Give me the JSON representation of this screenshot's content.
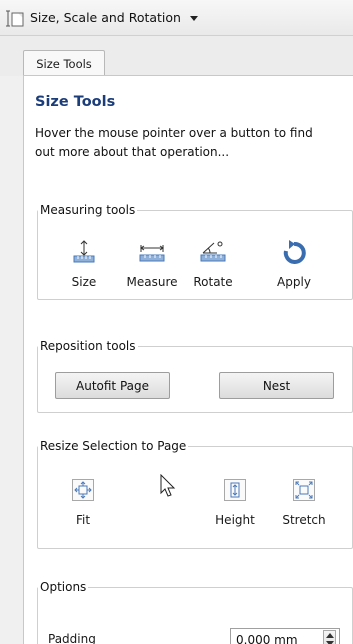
{
  "header": {
    "title": "Size, Scale and Rotation"
  },
  "tabs": [
    {
      "label": "Size Tools"
    }
  ],
  "panel": {
    "title": "Size Tools",
    "description": "Hover the mouse pointer over a button to find out more about that operation..."
  },
  "measuring": {
    "legend": "Measuring tools",
    "tools": [
      {
        "label": "Size",
        "icon": "size-icon"
      },
      {
        "label": "Measure",
        "icon": "measure-icon"
      },
      {
        "label": "Rotate",
        "icon": "rotate-angle-icon"
      },
      {
        "label": "Apply",
        "icon": "apply-rotate-icon"
      }
    ]
  },
  "reposition": {
    "legend": "Reposition tools",
    "buttons": [
      {
        "label": "Autofit Page"
      },
      {
        "label": "Nest"
      }
    ]
  },
  "resize": {
    "legend": "Resize Selection to Page",
    "tools": [
      {
        "label": "Fit",
        "icon": "fit-icon"
      },
      {
        "label": "Height",
        "icon": "height-icon"
      },
      {
        "label": "Stretch",
        "icon": "stretch-icon"
      }
    ]
  },
  "options": {
    "legend": "Options",
    "padding_label": "Padding",
    "padding_value": "0.000 mm"
  },
  "colors": {
    "accent_blue": "#1b3d7a",
    "icon_blue": "#4a78b8"
  }
}
